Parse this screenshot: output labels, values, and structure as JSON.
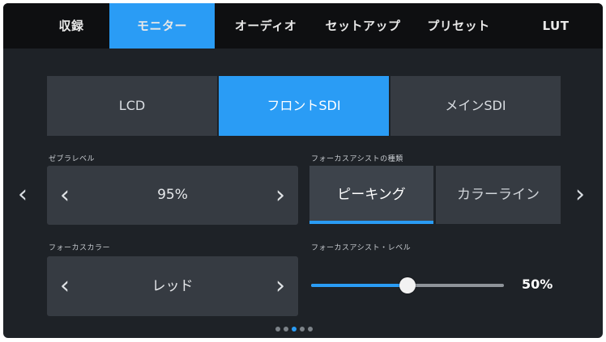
{
  "tabs": [
    {
      "label": "収録",
      "active": false
    },
    {
      "label": "モニター",
      "active": true
    },
    {
      "label": "オーディオ",
      "active": false
    },
    {
      "label": "セットアップ",
      "active": false
    },
    {
      "label": "プリセット",
      "active": false
    },
    {
      "label": "LUT",
      "active": false
    }
  ],
  "output_selector": {
    "options": [
      "LCD",
      "フロントSDI",
      "メインSDI"
    ],
    "selected": "フロントSDI"
  },
  "zebra_level": {
    "label": "ゼブラレベル",
    "value": "95%"
  },
  "focus_assist_type": {
    "label": "フォーカスアシストの種類",
    "options": [
      "ピーキング",
      "カラーライン"
    ],
    "selected": "ピーキング"
  },
  "focus_color": {
    "label": "フォーカスカラー",
    "value": "レッド"
  },
  "focus_assist_level": {
    "label": "フォーカスアシスト・レベル",
    "value_text": "50%",
    "value_fraction": 0.5
  },
  "pagination": {
    "total": 5,
    "current": 3
  },
  "icons": {
    "prev": "chevron-left-icon",
    "next": "chevron-right-icon"
  },
  "colors": {
    "accent": "#2a9cf5",
    "background": "#1e2227",
    "tabbar": "#0e0f11",
    "control": "#363b42"
  }
}
